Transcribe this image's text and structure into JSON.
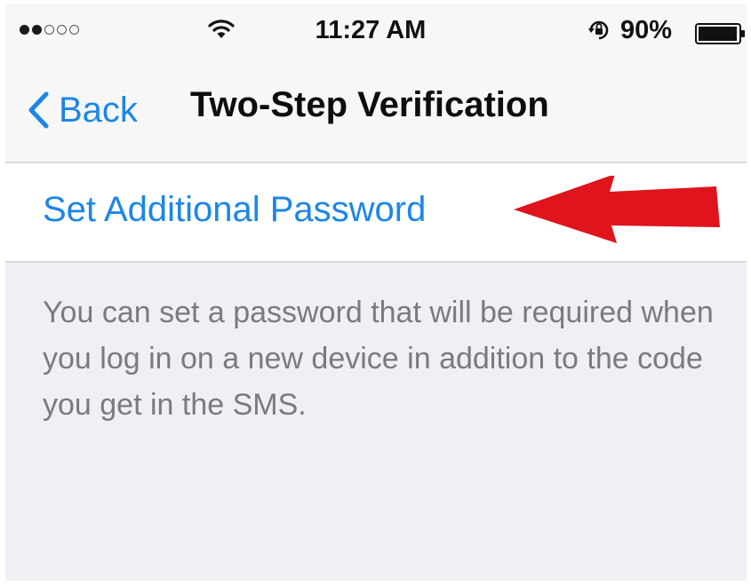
{
  "status_bar": {
    "signal_filled": 2,
    "signal_total": 5,
    "wifi_icon": "wifi-icon",
    "time": "11:27 AM",
    "rotation_lock_icon": "rotation-lock-icon",
    "battery_percent": "90%",
    "battery_level": 0.9
  },
  "nav_bar": {
    "back_icon": "chevron-left-icon",
    "back_label": "Back",
    "title": "Two-Step Verification"
  },
  "settings": {
    "set_password_label": "Set Additional Password",
    "annotation_icon": "red-arrow-icon",
    "description": "You can set a password that will be required when you log in on a new device in addition to the code you get in the SMS."
  },
  "colors": {
    "accent": "#1c86e8",
    "annotation": "#e0141d",
    "background": "#efeff4"
  }
}
